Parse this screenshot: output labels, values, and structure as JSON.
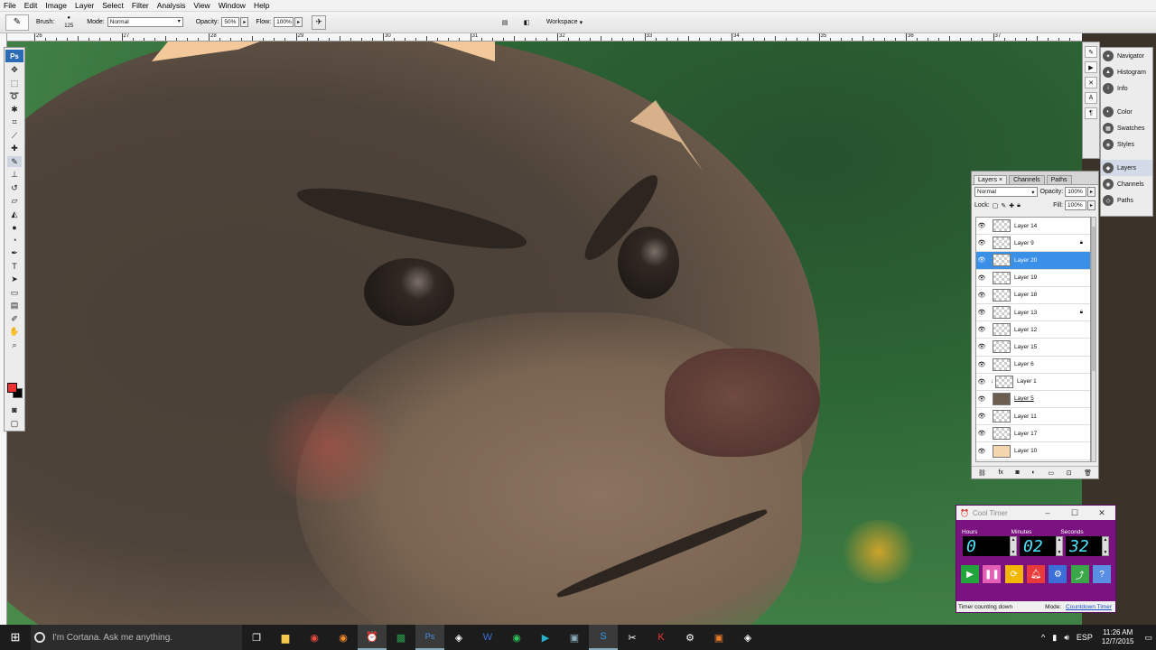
{
  "menubar": {
    "items": [
      "File",
      "Edit",
      "Image",
      "Layer",
      "Select",
      "Filter",
      "Analysis",
      "View",
      "Window",
      "Help"
    ]
  },
  "options": {
    "brush_label": "Brush:",
    "brush_size": "125",
    "mode_label": "Mode:",
    "mode_value": "Normal",
    "opacity_label": "Opacity:",
    "opacity_value": "50%",
    "flow_label": "Flow:",
    "flow_value": "100%",
    "workspace_label": "Workspace"
  },
  "ruler": {
    "labels": [
      "26",
      "27",
      "28",
      "29",
      "30",
      "31",
      "32",
      "33",
      "34",
      "35",
      "36",
      "37"
    ]
  },
  "toolbox": {
    "logo": "Ps",
    "tools": [
      "move",
      "marquee",
      "lasso",
      "magic-wand",
      "crop",
      "slice",
      "healing",
      "brush",
      "stamp",
      "history-brush",
      "eraser",
      "gradient",
      "blur",
      "dodge",
      "pen",
      "type",
      "path-select",
      "shape",
      "notes",
      "eyedropper",
      "hand",
      "zoom"
    ],
    "foreground_color": "#e33b3b",
    "background_color": "#000000"
  },
  "dock": {
    "items": [
      {
        "label": "Navigator",
        "icon": "navigator-icon"
      },
      {
        "label": "Histogram",
        "icon": "histogram-icon"
      },
      {
        "label": "Info",
        "icon": "info-icon"
      },
      {
        "label": "Color",
        "icon": "color-icon"
      },
      {
        "label": "Swatches",
        "icon": "swatches-icon"
      },
      {
        "label": "Styles",
        "icon": "styles-icon"
      },
      {
        "label": "Layers",
        "icon": "layers-icon"
      },
      {
        "label": "Channels",
        "icon": "channels-icon"
      },
      {
        "label": "Paths",
        "icon": "paths-icon"
      }
    ]
  },
  "layers_panel": {
    "tabs": [
      "Layers",
      "Channels",
      "Paths"
    ],
    "blend_mode": "Normal",
    "opacity_label": "Opacity:",
    "opacity_value": "100%",
    "lock_label": "Lock:",
    "fill_label": "Fill:",
    "fill_value": "100%",
    "layers": [
      {
        "name": "Layer 14",
        "locked": false,
        "selected": false
      },
      {
        "name": "Layer 9",
        "locked": true,
        "selected": false
      },
      {
        "name": "Layer 20",
        "locked": false,
        "selected": true
      },
      {
        "name": "Layer 19",
        "locked": false,
        "selected": false
      },
      {
        "name": "Layer 18",
        "locked": false,
        "selected": false
      },
      {
        "name": "Layer 13",
        "locked": true,
        "selected": false
      },
      {
        "name": "Layer 12",
        "locked": false,
        "selected": false
      },
      {
        "name": "Layer 15",
        "locked": false,
        "selected": false
      },
      {
        "name": "Layer 6",
        "locked": false,
        "selected": false
      },
      {
        "name": "Layer 1",
        "locked": false,
        "selected": false
      },
      {
        "name": "Layer 5",
        "locked": false,
        "selected": false
      },
      {
        "name": "Layer 11",
        "locked": false,
        "selected": false
      },
      {
        "name": "Layer 17",
        "locked": false,
        "selected": false
      },
      {
        "name": "Layer 10",
        "locked": false,
        "selected": false
      }
    ]
  },
  "timer": {
    "title": "Cool Timer",
    "hours_label": "Hours",
    "minutes_label": "Minutes",
    "seconds_label": "Seconds",
    "hours": "0",
    "minutes": "02",
    "seconds": "32",
    "status": "Timer counting down",
    "mode_label": "Mode:",
    "mode_value": "Countdown Timer",
    "buttons": [
      {
        "icon": "play-icon",
        "color": "#22a43a"
      },
      {
        "icon": "pause-icon",
        "color": "#e35fb6"
      },
      {
        "icon": "reset-icon",
        "color": "#f2b705"
      },
      {
        "icon": "alarm-icon",
        "color": "#e83a3a"
      },
      {
        "icon": "settings-icon",
        "color": "#3a6ed8"
      },
      {
        "icon": "share-icon",
        "color": "#3aa648"
      },
      {
        "icon": "help-icon",
        "color": "#5a8fe6"
      }
    ]
  },
  "taskbar": {
    "search_placeholder": "I'm Cortana. Ask me anything.",
    "language": "ESP",
    "time": "11:26 AM",
    "date": "12/7/2015"
  }
}
